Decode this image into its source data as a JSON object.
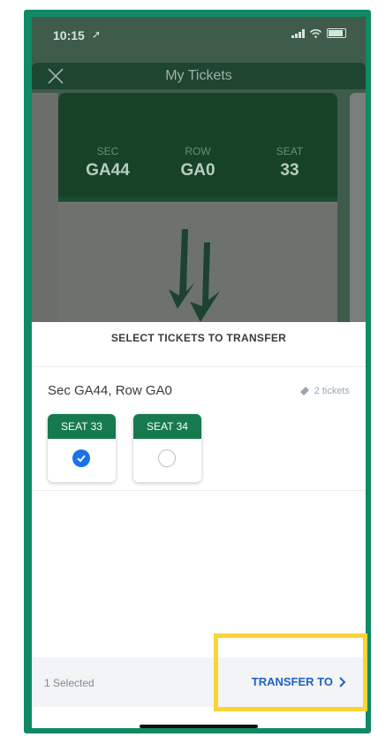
{
  "status": {
    "time": "10:15"
  },
  "header": {
    "title": "My Tickets"
  },
  "ticket": {
    "sec_label": "SEC",
    "sec_value": "GA44",
    "row_label": "ROW",
    "row_value": "GA0",
    "seat_label": "SEAT",
    "seat_value": "33"
  },
  "sheet": {
    "title": "SELECT TICKETS TO TRANSFER",
    "group_title": "Sec GA44, Row GA0",
    "ticket_count": "2 tickets",
    "seats": [
      {
        "label": "SEAT 33",
        "selected": true
      },
      {
        "label": "SEAT 34",
        "selected": false
      }
    ]
  },
  "footer": {
    "selected": "1 Selected",
    "transfer": "TRANSFER TO"
  },
  "colors": {
    "accent_green": "#177a4f",
    "accent_blue": "#1e63c3",
    "highlight": "#fcd337"
  }
}
